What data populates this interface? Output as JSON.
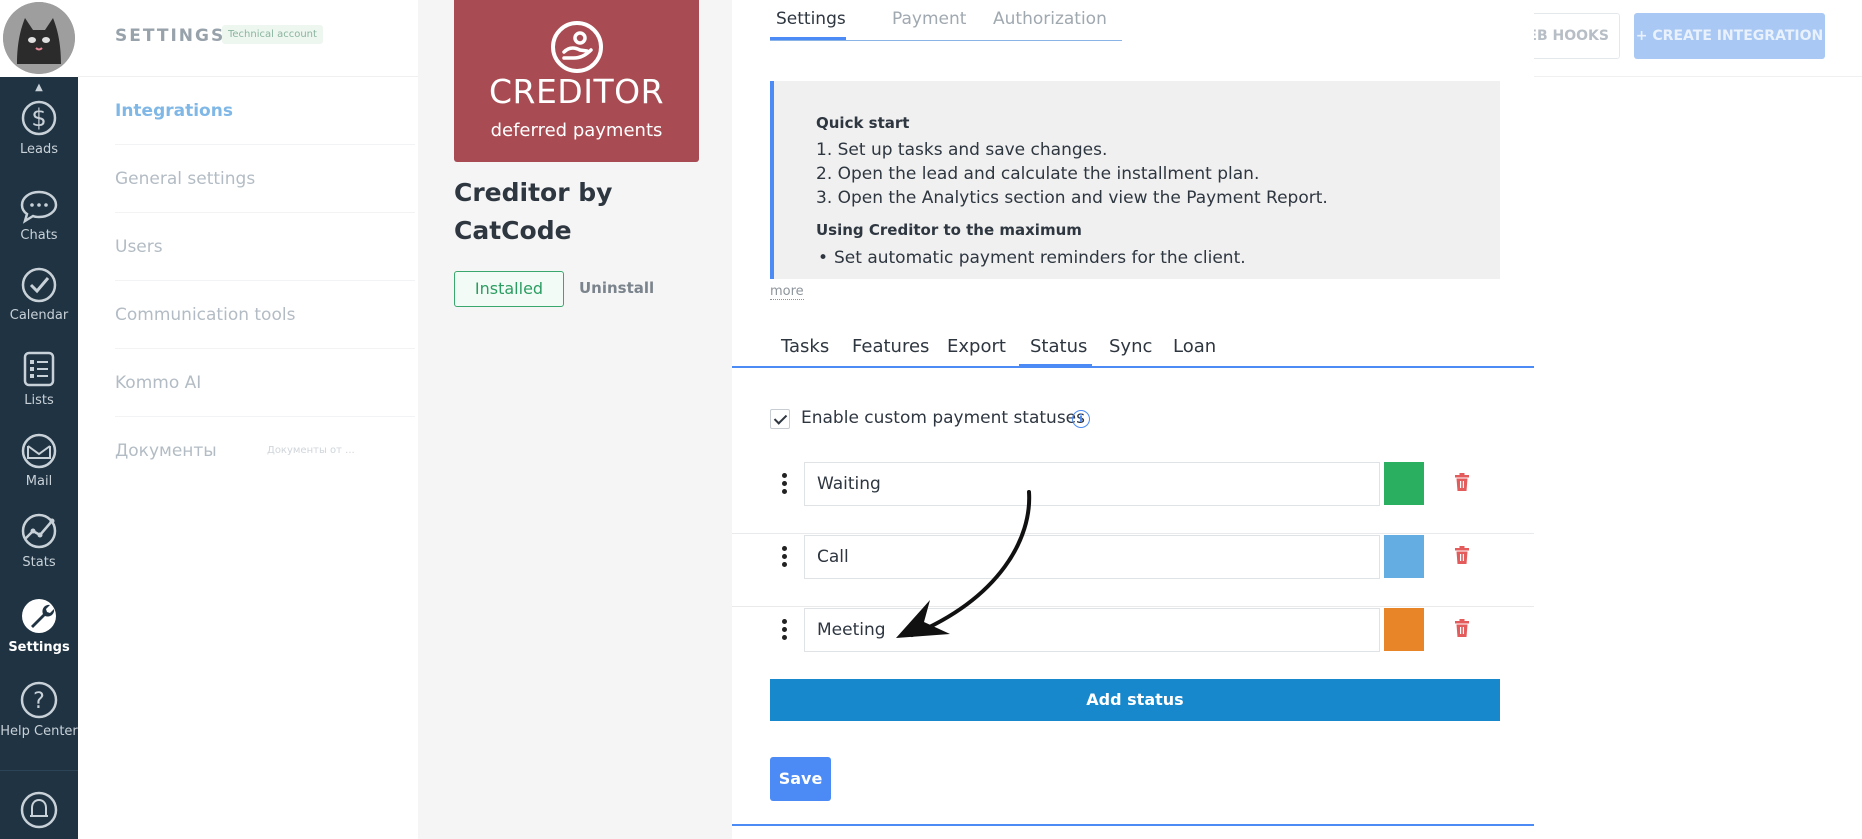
{
  "nav": {
    "items": [
      {
        "label": "Leads",
        "icon": "leads-icon"
      },
      {
        "label": "Chats",
        "icon": "chats-icon"
      },
      {
        "label": "Calendar",
        "icon": "calendar-icon"
      },
      {
        "label": "Lists",
        "icon": "lists-icon"
      },
      {
        "label": "Mail",
        "icon": "mail-icon"
      },
      {
        "label": "Stats",
        "icon": "stats-icon"
      },
      {
        "label": "Settings",
        "icon": "settings-icon"
      },
      {
        "label": "Help Center",
        "icon": "help-icon"
      }
    ],
    "active": "Settings",
    "bottom_icon": "bell-icon"
  },
  "settings": {
    "title": "SETTINGS",
    "badge": "Technical account",
    "menu": [
      {
        "label": "Integrations"
      },
      {
        "label": "General settings"
      },
      {
        "label": "Users"
      },
      {
        "label": "Communication tools"
      },
      {
        "label": "Kommo AI"
      },
      {
        "label": "Документы",
        "sub": "Документы от ..."
      }
    ],
    "active_menu": "Integrations"
  },
  "header_actions": {
    "webhooks": "WEB HOOKS",
    "create": "+ CREATE INTEGRATION"
  },
  "integration": {
    "logo_title": "CREDITOR",
    "logo_sub": "deferred payments",
    "name": "Creditor by CatCode",
    "installed_label": "Installed",
    "uninstall_label": "Uninstall",
    "brand_color": "#a84b52"
  },
  "top_tabs": {
    "items": [
      "Settings",
      "Payment",
      "Authorization"
    ],
    "active": "Settings"
  },
  "description": {
    "heading": "Quick start",
    "steps": [
      "1. Set up tasks and save changes.",
      "2. Open the lead and calculate the installment plan.",
      "3. Open the Analytics section and view the Payment Report."
    ],
    "heading2": "Using Creditor to the maximum",
    "bullets": [
      "Set automatic payment reminders for the client."
    ],
    "more": "more"
  },
  "sub_tabs": {
    "items": [
      "Tasks",
      "Features",
      "Export",
      "Status",
      "Sync",
      "Loan"
    ],
    "active": "Status"
  },
  "status_settings": {
    "enable_label": "Enable custom payment statuses",
    "enable_checked": true,
    "statuses": [
      {
        "name": "Waiting",
        "color": "#2aae5f"
      },
      {
        "name": "Call",
        "color": "#64ade3"
      },
      {
        "name": "Meeting",
        "color": "#e88529"
      }
    ],
    "add_label": "Add status",
    "save_label": "Save"
  },
  "colors": {
    "accent": "#4c8bf5",
    "add_button": "#1888cd",
    "installed": "#2c9d62",
    "nav_bg": "#1f3342"
  }
}
